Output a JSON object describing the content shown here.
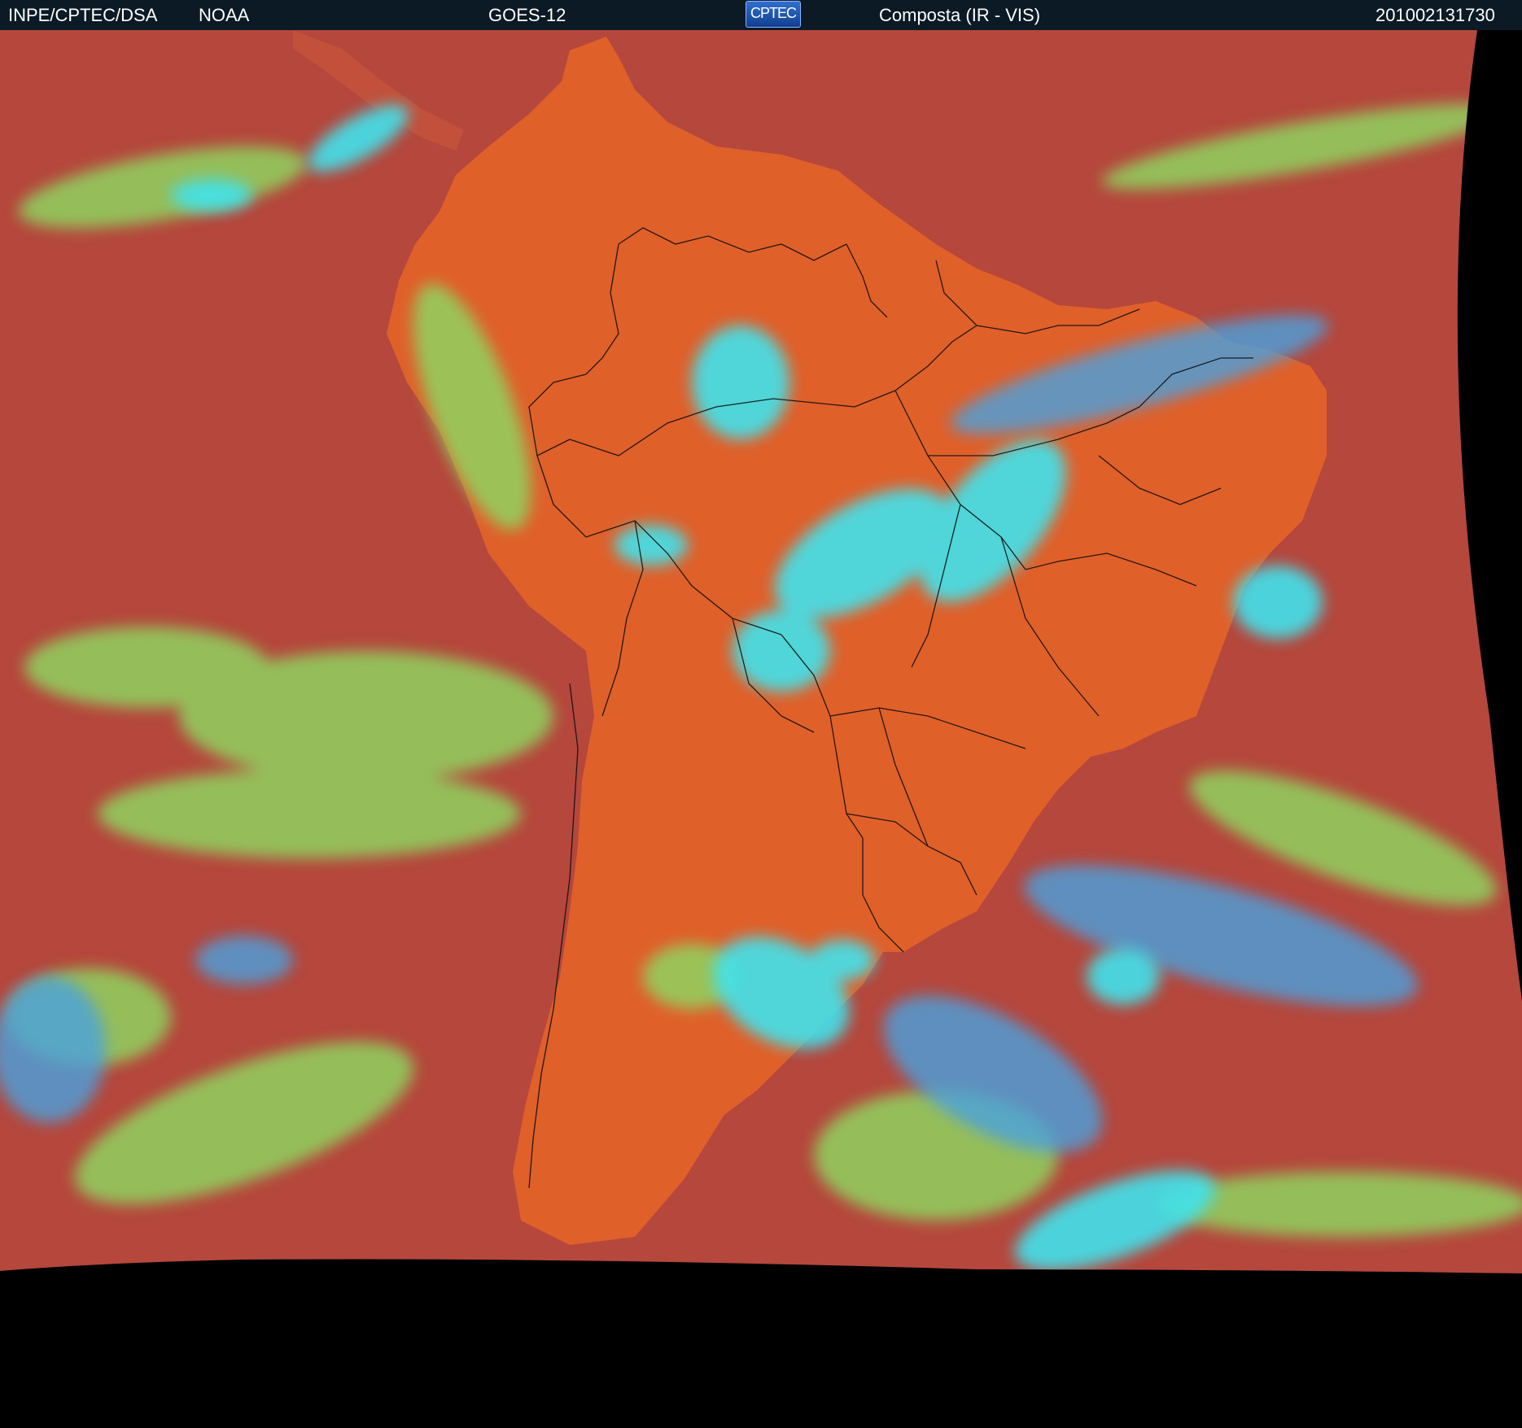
{
  "header": {
    "agency": "INPE/CPTEC/DSA",
    "partner": "NOAA",
    "satellite": "GOES-12",
    "logo_text": "CPTEC",
    "product": "Composta (IR - VIS)",
    "timestamp": "201002131730"
  },
  "colors": {
    "header_bg": "#0b1a25",
    "ocean_clear": "#b5473c",
    "land_clear": "#e0602a",
    "low_cloud": "#8fd460",
    "high_cloud": "#3fe3ee",
    "mid_cloud": "#4aa2e0",
    "space": "#000000",
    "borders": "#111111"
  },
  "map": {
    "region": "South America",
    "projection_view": "satellite-disk"
  }
}
